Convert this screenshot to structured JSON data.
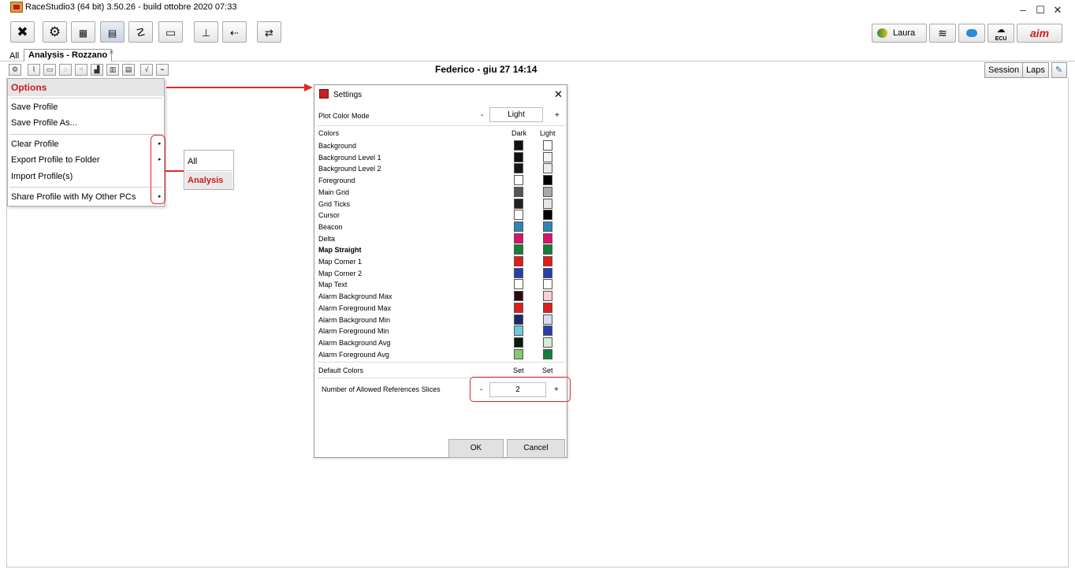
{
  "window": {
    "title": "RaceStudio3 (64 bit) 3.50.26 - build ottobre 2020 07:33",
    "minimize": "–",
    "maximize": "☐",
    "close": "✕"
  },
  "toolbar": {
    "user_label": "Laura",
    "ecu_label": "ECU",
    "brand_label": "aim"
  },
  "tabs": {
    "all_label": "All",
    "analysis_label": "Analysis - Rozzano",
    "close_glyph": "✕"
  },
  "analysis": {
    "header_title": "Federico - giu 27 14:14",
    "session_label": "Session",
    "laps_label": "Laps"
  },
  "options_menu": {
    "header": "Options",
    "items": [
      "Save Profile",
      "Save Profile As...",
      "Clear Profile",
      "Export Profile to Folder",
      "Import Profile(s)",
      "Share Profile with My Other PCs"
    ],
    "arrow_glyph": "▸"
  },
  "submenu": {
    "items": [
      "All",
      "Analysis"
    ]
  },
  "settings": {
    "title": "Settings",
    "close_glyph": "✕",
    "plot_color_mode_label": "Plot Color Mode",
    "plot_color_mode_value": "Light",
    "minus": "-",
    "plus": "+",
    "colors_label": "Colors",
    "dark_label": "Dark",
    "light_label": "Light",
    "color_rows": [
      {
        "label": "Background",
        "dark": "#111111",
        "light": "#ffffff"
      },
      {
        "label": "Background Level 1",
        "dark": "#111111",
        "light": "#f4f4f4"
      },
      {
        "label": "Background Level 2",
        "dark": "#151515",
        "light": "#ececec"
      },
      {
        "label": "Foreground",
        "dark": "#ffffff",
        "light": "#000000"
      },
      {
        "label": "Main Grid",
        "dark": "#555555",
        "light": "#aaaaaa"
      },
      {
        "label": "Grid Ticks",
        "dark": "#222222",
        "light": "#e4e4e4"
      },
      {
        "label": "Cursor",
        "dark": "#ffffff",
        "light": "#000000"
      },
      {
        "label": "Beacon",
        "dark": "#2e86b8",
        "light": "#2e86b8"
      },
      {
        "label": "Delta",
        "dark": "#e0106a",
        "light": "#e0106a"
      },
      {
        "label": "Map Straight",
        "dark": "#14803a",
        "light": "#14803a",
        "bold": true
      },
      {
        "label": "Map Corner 1",
        "dark": "#e01c1c",
        "light": "#e01c1c"
      },
      {
        "label": "Map Corner 2",
        "dark": "#2a3fa6",
        "light": "#2a3fa6"
      },
      {
        "label": "Map Text",
        "dark": "#ffffff",
        "light": "#ffffff"
      },
      {
        "label": "Alarm Background Max",
        "dark": "#2a0c0c",
        "light": "#f8d0d0"
      },
      {
        "label": "Alarm Foreground Max",
        "dark": "#e01c1c",
        "light": "#e01c1c"
      },
      {
        "label": "Alarm Background Min",
        "dark": "#1c2a6a",
        "light": "#d6dcf0"
      },
      {
        "label": "Alarm Foreground Min",
        "dark": "#6ecbd8",
        "light": "#2a3fa6"
      },
      {
        "label": "Alarm Background Avg",
        "dark": "#0c1c0c",
        "light": "#d6ecd6"
      },
      {
        "label": "Alarm Foreground Avg",
        "dark": "#86c96e",
        "light": "#14803a"
      }
    ],
    "default_colors_label": "Default Colors",
    "set_dark": "Set",
    "set_light": "Set",
    "slices_label": "Number of Allowed References Slices",
    "slices_value": "2",
    "ok_label": "OK",
    "cancel_label": "Cancel"
  },
  "accent": "#e12a2a"
}
